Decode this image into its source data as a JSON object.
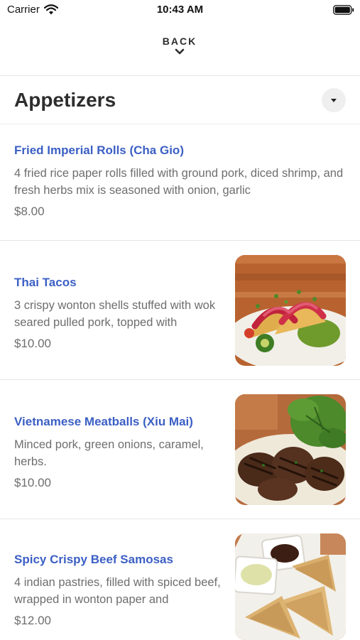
{
  "status_bar": {
    "carrier": "Carrier",
    "time": "10:43 AM",
    "icons": [
      "wifi-icon",
      "battery-icon"
    ]
  },
  "header": {
    "back_label": "BACK",
    "icon": "chevron-down-icon"
  },
  "section": {
    "title": "Appetizers",
    "toggle_icon": "caret-down-icon"
  },
  "colors": {
    "item_name": "#3b5fc4",
    "body_text": "#6e6e6e",
    "divider": "#e6e6e6",
    "toggle_bg": "#efefef"
  },
  "menu": {
    "items": [
      {
        "name": "Fried Imperial Rolls (Cha Gio)",
        "description": "4 fried rice paper rolls filled with ground pork, diced shrimp, and fresh herbs mix is seasoned with onion, garlic",
        "price": "$8.00",
        "has_photo": false
      },
      {
        "name": "Thai Tacos",
        "description": "3 crispy wonton shells stuffed with wok seared pulled pork, topped with",
        "price": "$10.00",
        "has_photo": true,
        "photo": "thai-tacos-photo"
      },
      {
        "name": "Vietnamese Meatballs (Xiu Mai)",
        "description": "Minced pork, green onions, caramel, herbs.",
        "price": "$10.00",
        "has_photo": true,
        "photo": "meatballs-photo"
      },
      {
        "name": "Spicy Crispy Beef Samosas",
        "description": "4 indian pastries, filled with spiced beef, wrapped in wonton paper and",
        "price": "$12.00",
        "has_photo": true,
        "photo": "samosas-photo"
      }
    ]
  }
}
